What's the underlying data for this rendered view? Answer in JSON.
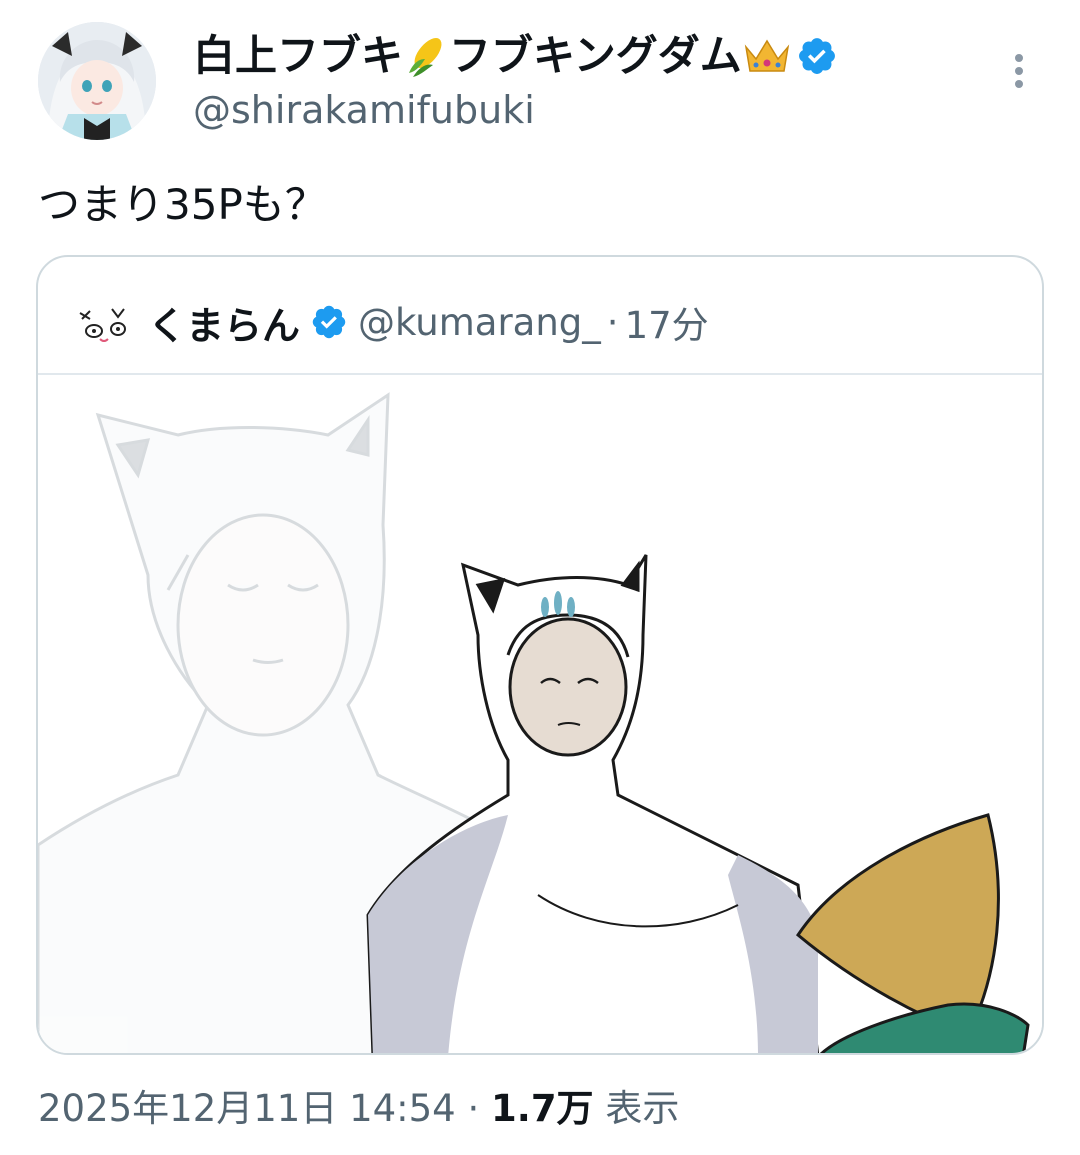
{
  "author": {
    "display_name": "白上フブキ",
    "display_name_suffix": "フブキングダム",
    "handle": "@shirakamifubuki",
    "verified": true,
    "avatar": "anime-girl-avatar",
    "name_emojis": [
      "corn-emoji",
      "crown-emoji"
    ]
  },
  "tweet": {
    "text": "つまり35Pも？"
  },
  "quoted_tweet": {
    "display_name": "くまらん",
    "handle": "@kumarang_",
    "separator": "·",
    "time": "17分",
    "verified": true,
    "avatar": "face-doodle-avatar",
    "image": "illustration-cat-hood-man"
  },
  "meta": {
    "date": "2025年12月11日 14:54",
    "separator": "·",
    "views_count": "1.7万",
    "views_label": "表示"
  },
  "colors": {
    "text": "#0f1419",
    "secondary": "#536471",
    "verified_blue": "#1d9bf0",
    "border": "#cfd9de"
  }
}
